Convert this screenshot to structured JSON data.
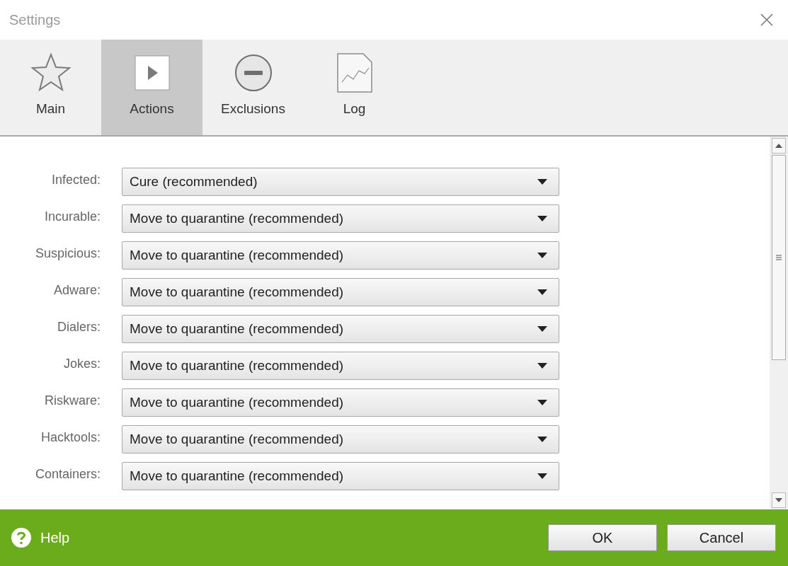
{
  "window": {
    "title": "Settings"
  },
  "tabs": [
    {
      "label": "Main",
      "selected": false
    },
    {
      "label": "Actions",
      "selected": true
    },
    {
      "label": "Exclusions",
      "selected": false
    },
    {
      "label": "Log",
      "selected": false
    }
  ],
  "actions": [
    {
      "label": "Infected:",
      "value": "Cure (recommended)"
    },
    {
      "label": "Incurable:",
      "value": "Move to quarantine (recommended)"
    },
    {
      "label": "Suspicious:",
      "value": "Move to quarantine (recommended)"
    },
    {
      "label": "Adware:",
      "value": "Move to quarantine (recommended)"
    },
    {
      "label": "Dialers:",
      "value": "Move to quarantine (recommended)"
    },
    {
      "label": "Jokes:",
      "value": "Move to quarantine (recommended)"
    },
    {
      "label": "Riskware:",
      "value": "Move to quarantine (recommended)"
    },
    {
      "label": "Hacktools:",
      "value": "Move to quarantine (recommended)"
    },
    {
      "label": "Containers:",
      "value": "Move to quarantine (recommended)"
    }
  ],
  "footer": {
    "help": "Help",
    "buttons": [
      "OK",
      "Cancel"
    ]
  }
}
